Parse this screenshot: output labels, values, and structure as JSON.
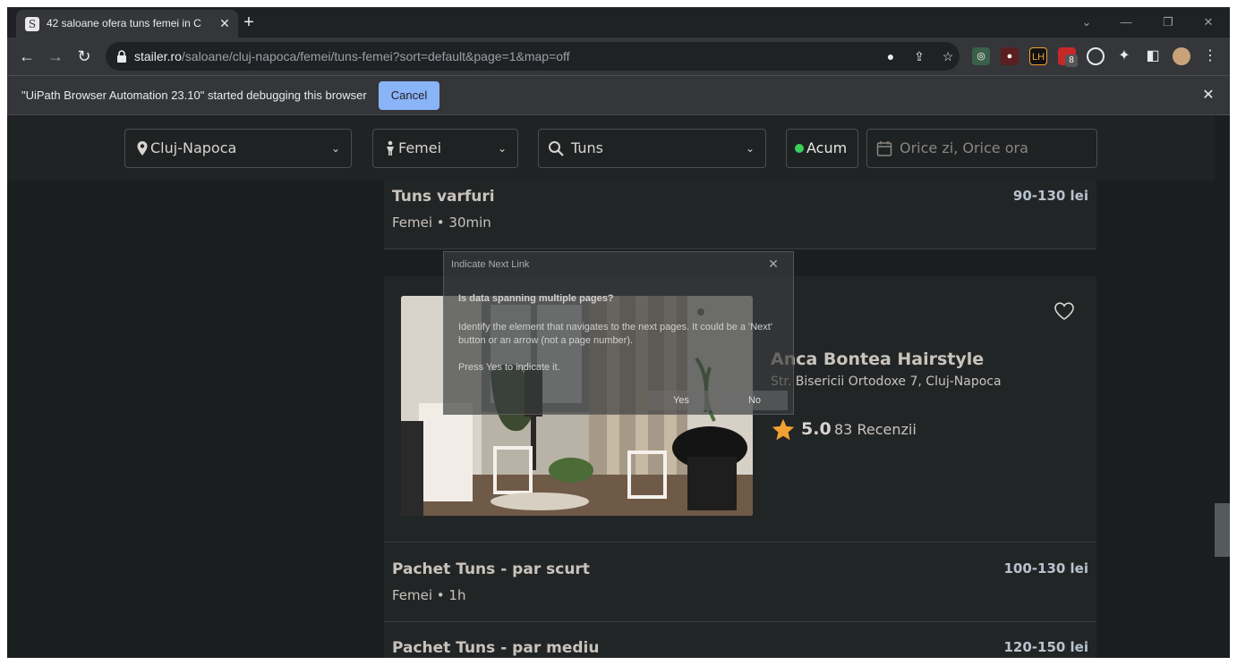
{
  "browser": {
    "tab_title": "42 saloane ofera tuns femei in C",
    "tab_favicon": "S",
    "url_host": "stailer.ro",
    "url_path": "/saloane/cluj-napoca/femei/tuns-femei?sort=default&page=1&map=off",
    "extension_badge": "8",
    "ext_lh_label": "LH"
  },
  "debug_bar": {
    "message": "\"UiPath Browser Automation 23.10\" started debugging this browser",
    "cancel_label": "Cancel"
  },
  "search": {
    "city": "Cluj-Napoca",
    "gender": "Femei",
    "service": "Tuns",
    "now_label": "Acum",
    "date_placeholder": "Orice zi, Orice ora"
  },
  "services_top": {
    "title": "Tuns varfuri",
    "sub": "Femei • 30min",
    "price": "90-130 lei"
  },
  "salon": {
    "name": "Anca Bontea Hairstyle",
    "address": "Str. Bisericii Ortodoxe 7, Cluj-Napoca",
    "rating": "5.0",
    "reviews": "83 Recenzii"
  },
  "services_bottom": [
    {
      "title": "Pachet Tuns - par scurt",
      "sub": "Femei • 1h",
      "price": "100-130 lei"
    },
    {
      "title": "Pachet Tuns - par mediu",
      "price": "120-150 lei"
    }
  ],
  "dialog": {
    "title": "Indicate Next Link",
    "heading": "Is data spanning multiple pages?",
    "body": "Identify the element that navigates to the next pages. It could be a 'Next' button or an arrow (not a page number).",
    "press": "Press Yes to indicate it.",
    "yes": "Yes",
    "no": "No"
  },
  "colors": {
    "accent_blue": "#8ab4f8",
    "star": "#f0a132",
    "now_dot": "#3ccf5a"
  }
}
